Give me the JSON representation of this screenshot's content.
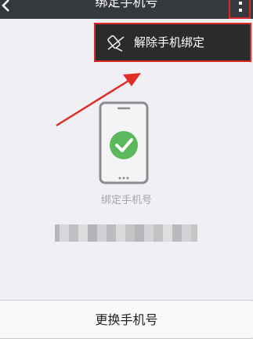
{
  "header": {
    "title": "绑定手机号",
    "back_icon": "chevron-left-icon",
    "more_icon": "more-vertical-icon"
  },
  "menu": {
    "items": [
      {
        "icon": "unbind-phone-icon",
        "label": "解除手机绑定"
      }
    ]
  },
  "main": {
    "illustration_icon": "phone-check-icon",
    "caption": "绑定手机号",
    "phone_number_masked": true
  },
  "footer": {
    "change_button_label": "更换手机号"
  },
  "colors": {
    "topbar": "#35383c",
    "menu_background": "#2b2b2d",
    "highlight_red": "#d52a26",
    "check_green": "#5cb85c",
    "page_background": "#efeff4"
  }
}
